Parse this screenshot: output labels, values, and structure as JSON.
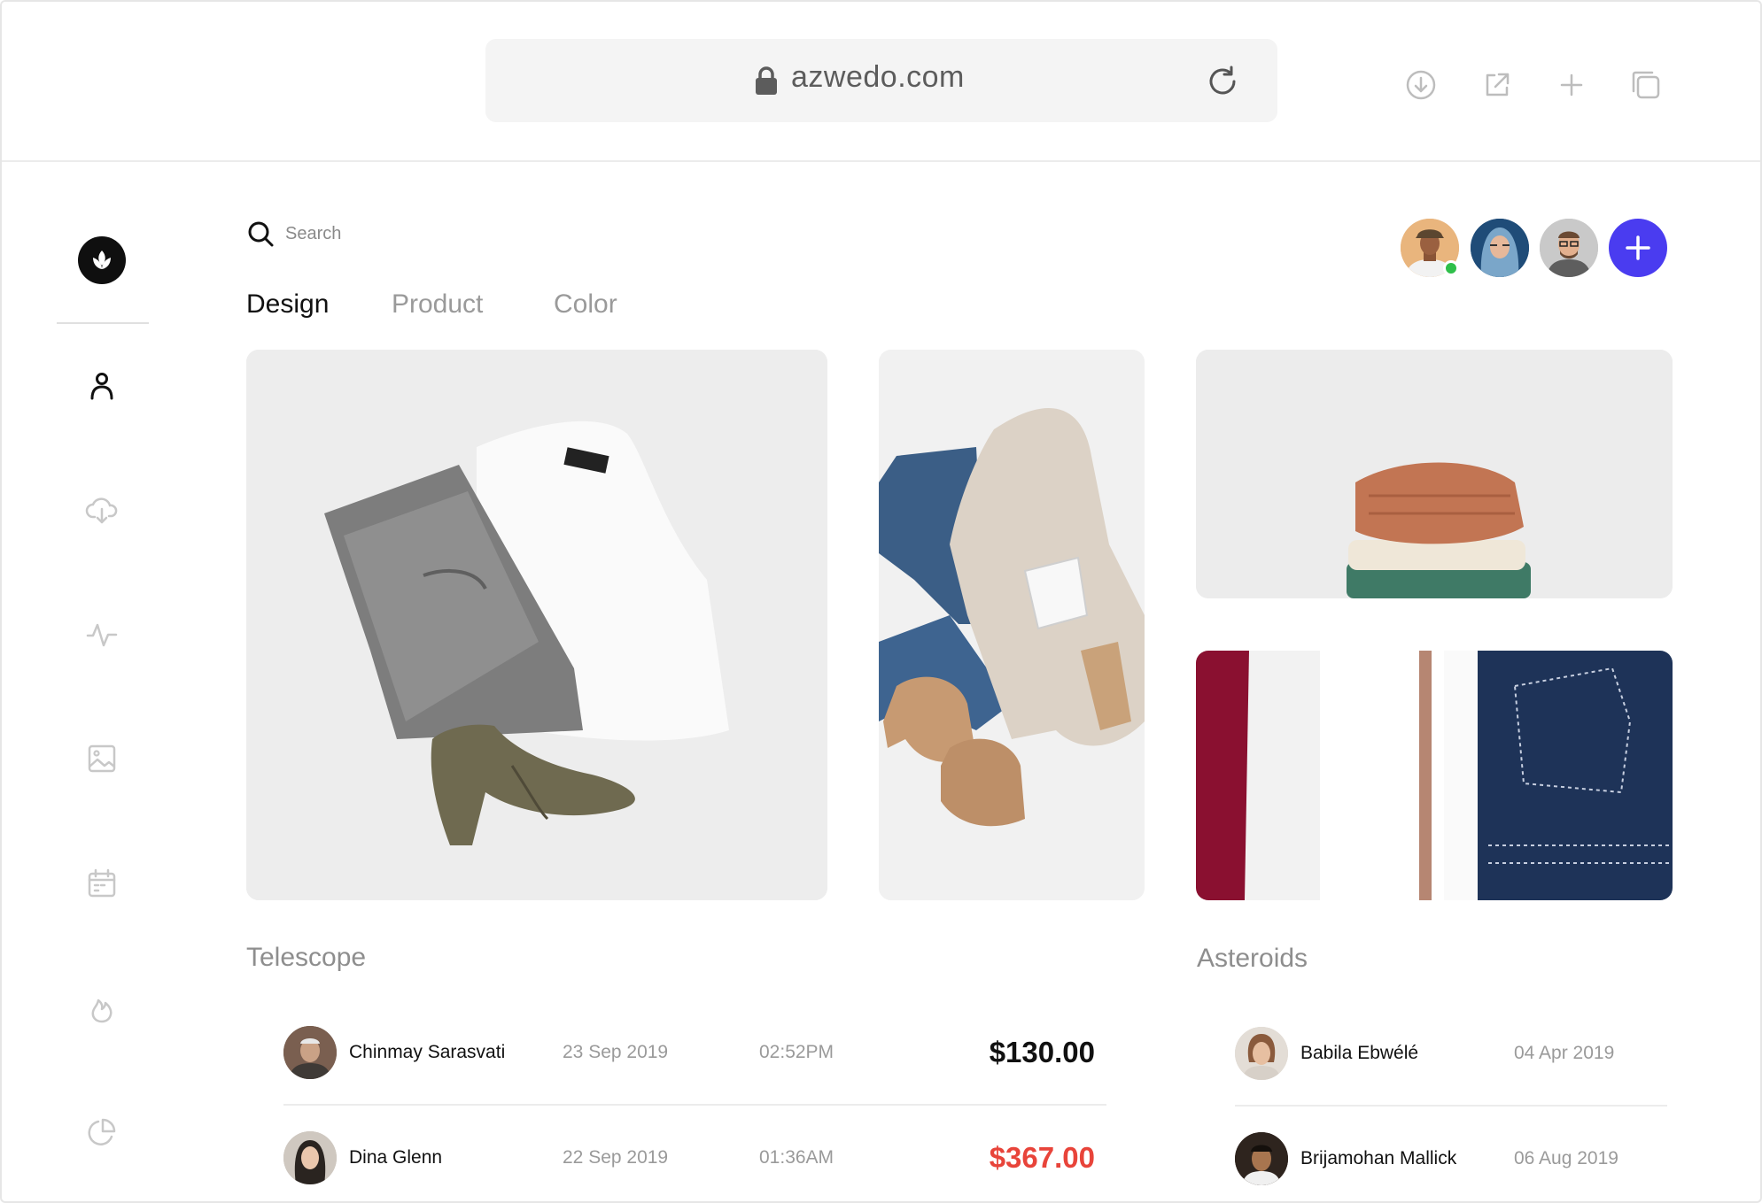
{
  "browser": {
    "url": "azwedo.com",
    "icons": [
      "lock-icon",
      "reload-icon",
      "download-icon",
      "share-icon",
      "new-tab-icon",
      "tabs-icon"
    ]
  },
  "sidebar": {
    "logo": "leaf-logo-icon",
    "items": [
      "user-icon",
      "cloud-download-icon",
      "activity-icon",
      "image-icon",
      "calendar-icon",
      "fire-icon",
      "pie-chart-icon"
    ]
  },
  "search": {
    "placeholder": "Search"
  },
  "tabs": [
    {
      "label": "Design",
      "active": true
    },
    {
      "label": "Product",
      "active": false
    },
    {
      "label": "Color",
      "active": false
    }
  ],
  "collaborators": {
    "count_shown": 3,
    "online_color": "#2fbf4a",
    "add_button_color": "#4a3cf0"
  },
  "telescope": {
    "title": "Telescope",
    "rows": [
      {
        "name": "Chinmay Sarasvati",
        "date": "23 Sep 2019",
        "time": "02:52PM",
        "amount": "$130.00",
        "amount_color": "#111111"
      },
      {
        "name": "Dina Glenn",
        "date": "22 Sep 2019",
        "time": "01:36AM",
        "amount": "$367.00",
        "amount_color": "#e8443a"
      }
    ]
  },
  "asteroids": {
    "title": "Asteroids",
    "rows": [
      {
        "name": "Babila Ebwélé",
        "date": "04 Apr 2019"
      },
      {
        "name": "Brijamohan Mallick",
        "date": "06 Aug 2019"
      }
    ]
  }
}
